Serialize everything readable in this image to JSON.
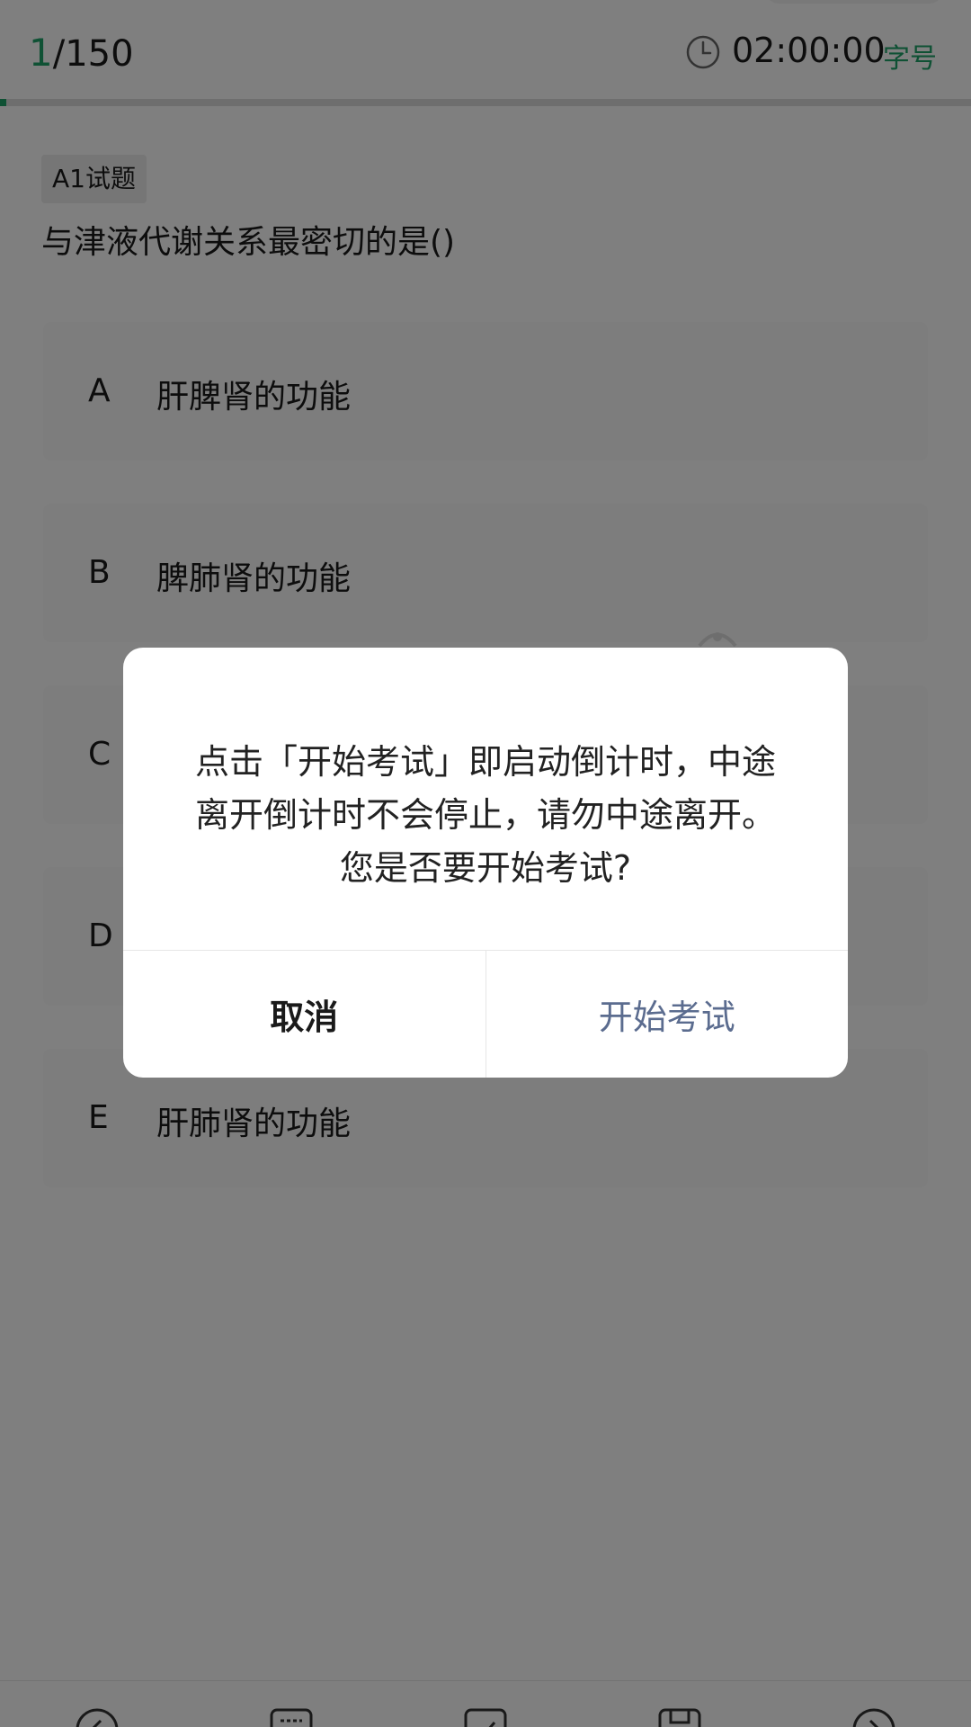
{
  "header": {
    "progress_current": "1",
    "progress_total": "/150",
    "progress_fraction": 0.0067,
    "timer": "02:00:00",
    "font_size_label": "字号",
    "accent_color": "#1ea269"
  },
  "question": {
    "type": "A1试题",
    "text": "与津液代谢关系最密切的是()",
    "options": [
      {
        "letter": "A",
        "text": "肝脾肾的功能"
      },
      {
        "letter": "B",
        "text": "脾肺肾的功能"
      },
      {
        "letter": "C",
        "text": ""
      },
      {
        "letter": "D",
        "text": ""
      },
      {
        "letter": "E",
        "text": "肝肺肾的功能"
      }
    ]
  },
  "dialog": {
    "message": "点击「开始考试」即启动倒计时，中途离开倒计时不会停止，请勿中途离开。您是否要开始考试?",
    "cancel_label": "取消",
    "confirm_label": "开始考试",
    "confirm_color": "#5b6c8f"
  },
  "toolbar": {
    "icons": [
      "chevron-left-icon",
      "list-icon",
      "check-icon",
      "save-icon",
      "chevron-right-icon"
    ]
  }
}
